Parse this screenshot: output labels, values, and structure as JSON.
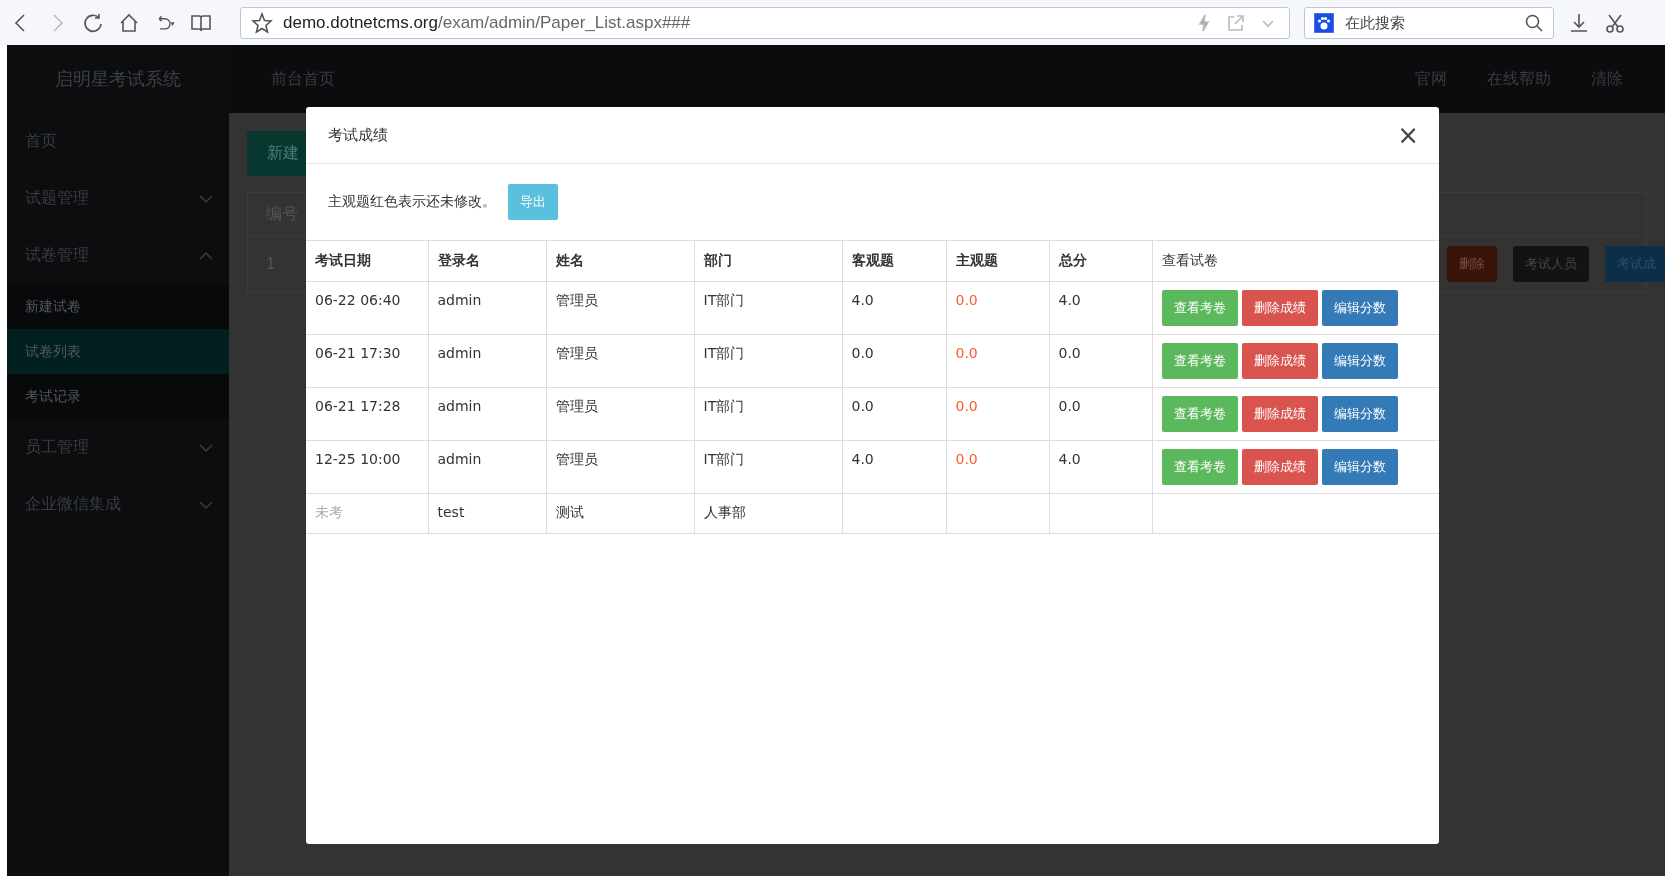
{
  "browser": {
    "url_host": "demo.dotnetcms.org",
    "url_path": "/exam/admin/Paper_List.aspx###",
    "search_placeholder": "在此搜索"
  },
  "sidebar": {
    "title": "启明星考试系统",
    "items": [
      {
        "label": "首页",
        "selected": false
      },
      {
        "label": "试题管理",
        "selected": false,
        "expanded": false
      },
      {
        "label": "试卷管理",
        "selected": false,
        "expanded": true,
        "children": [
          {
            "label": "新建试卷",
            "selected": false
          },
          {
            "label": "试卷列表",
            "selected": true
          },
          {
            "label": "考试记录",
            "selected": false
          }
        ]
      },
      {
        "label": "员工管理",
        "selected": false,
        "expanded": false
      },
      {
        "label": "企业微信集成",
        "selected": false,
        "expanded": false
      }
    ]
  },
  "topnav": {
    "left": [
      "前台首页"
    ],
    "right": [
      "官网",
      "在线帮助",
      "清除"
    ]
  },
  "background": {
    "new_button": "新建",
    "table_header": "编号",
    "row_number": "1",
    "row_buttons": [
      {
        "label": "删除",
        "kind": "danger"
      },
      {
        "label": "考试人员",
        "kind": "dark"
      },
      {
        "label": "考试成",
        "kind": "primary"
      }
    ]
  },
  "modal": {
    "title": "考试成绩",
    "close": "×",
    "note": "主观题红色表示还未修改。",
    "export_button": "导出",
    "columns": [
      "考试日期",
      "登录名",
      "姓名",
      "部门",
      "客观题",
      "主观题",
      "总分",
      "查看试卷"
    ],
    "rows": [
      {
        "kind": "taken",
        "date": "06-22 06:40",
        "login": "admin",
        "name": "管理员",
        "dept": "IT部门",
        "objective": "4.0",
        "subjective": "0.0",
        "subjective_modified": false,
        "total": "4.0",
        "actions": [
          {
            "label": "查看考卷",
            "kind": "view"
          },
          {
            "label": "删除成绩",
            "kind": "delete"
          },
          {
            "label": "编辑分数",
            "kind": "edit"
          }
        ]
      },
      {
        "kind": "taken",
        "date": "06-21 17:30",
        "login": "admin",
        "name": "管理员",
        "dept": "IT部门",
        "objective": "0.0",
        "subjective": "0.0",
        "subjective_modified": false,
        "total": "0.0",
        "actions": [
          {
            "label": "查看考卷",
            "kind": "view"
          },
          {
            "label": "删除成绩",
            "kind": "delete"
          },
          {
            "label": "编辑分数",
            "kind": "edit"
          }
        ]
      },
      {
        "kind": "taken",
        "date": "06-21 17:28",
        "login": "admin",
        "name": "管理员",
        "dept": "IT部门",
        "objective": "0.0",
        "subjective": "0.0",
        "subjective_modified": false,
        "total": "0.0",
        "actions": [
          {
            "label": "查看考卷",
            "kind": "view"
          },
          {
            "label": "删除成绩",
            "kind": "delete"
          },
          {
            "label": "编辑分数",
            "kind": "edit"
          }
        ]
      },
      {
        "kind": "taken",
        "date": "12-25 10:00",
        "login": "admin",
        "name": "管理员",
        "dept": "IT部门",
        "objective": "4.0",
        "subjective": "0.0",
        "subjective_modified": false,
        "total": "4.0",
        "actions": [
          {
            "label": "查看考卷",
            "kind": "view"
          },
          {
            "label": "删除成绩",
            "kind": "delete"
          },
          {
            "label": "编辑分数",
            "kind": "edit"
          }
        ]
      },
      {
        "kind": "not_taken",
        "date": "未考",
        "login": "test",
        "name": "测试",
        "dept": "人事部"
      }
    ]
  }
}
